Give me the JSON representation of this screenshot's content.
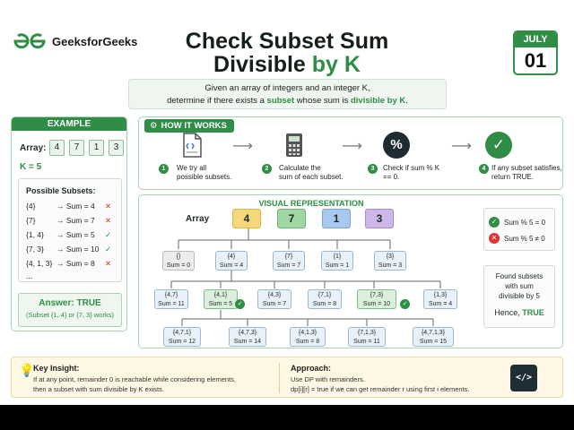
{
  "header": {
    "brand": "GeeksforGeeks",
    "title_line1": "Check Subset Sum",
    "title_line2_prefix": "Divisible ",
    "title_line2_highlight": "by K",
    "date_month": "JULY",
    "date_day": "01"
  },
  "intro": {
    "line1": "Given an array of integers and an integer K,",
    "line2_prefix": "determine if there exists a ",
    "line2_word1": "subset",
    "line2_middle": " whose sum is ",
    "line2_word2": "divisible by K",
    "line2_end": "."
  },
  "example": {
    "title": "EXAMPLE",
    "array_label": "Array:",
    "array": [
      "4",
      "7",
      "1",
      "3"
    ],
    "k_label": "K = 5",
    "subsets_title": "Possible Subsets:",
    "subsets": [
      {
        "set": "{4}",
        "sum": "→ Sum = 4",
        "ok": false
      },
      {
        "set": "{7}",
        "sum": "→ Sum = 7",
        "ok": false
      },
      {
        "set": "{1, 4}",
        "sum": "→ Sum = 5",
        "ok": true
      },
      {
        "set": "{7, 3}",
        "sum": "→ Sum = 10",
        "ok": true
      },
      {
        "set": "{4, 1, 3}",
        "sum": "→ Sum = 8",
        "ok": false
      }
    ],
    "more": "...",
    "answer_title": "Answer: TRUE",
    "answer_sub": "(Subset {1, 4} or {7, 3} works)"
  },
  "how": {
    "title": "HOW IT WORKS",
    "steps": [
      {
        "num": "1",
        "line1": "We try all",
        "line2": "possible subsets."
      },
      {
        "num": "2",
        "line1": "Calculate the",
        "line2": "sum of each subset."
      },
      {
        "num": "3",
        "line1": "Check if sum % K",
        "line2": "== 0."
      },
      {
        "num": "4",
        "line1": "If any subset satisfies,",
        "line2": "return TRUE."
      }
    ]
  },
  "visual": {
    "title": "VISUAL REPRESENTATION",
    "array_label": "Array",
    "array": [
      "4",
      "7",
      "1",
      "3"
    ],
    "level1": [
      {
        "set": "{}",
        "sum": "Sum = 0"
      },
      {
        "set": "{4}",
        "sum": "Sum = 4"
      },
      {
        "set": "{7}",
        "sum": "Sum = 7"
      },
      {
        "set": "{1}",
        "sum": "Sum = 1"
      },
      {
        "set": "{3}",
        "sum": "Sum = 3"
      }
    ],
    "level2": [
      {
        "set": "{4,7}",
        "sum": "Sum = 11"
      },
      {
        "set": "{4,1}",
        "sum": "Sum = 5"
      },
      {
        "set": "{4,3}",
        "sum": "Sum = 7"
      },
      {
        "set": "{7,1}",
        "sum": "Sum = 8"
      },
      {
        "set": "{7,3}",
        "sum": "Sum = 10"
      },
      {
        "set": "{1,3}",
        "sum": "Sum = 4"
      }
    ],
    "level3": [
      {
        "set": "{4,7,1}",
        "sum": "Sum = 12"
      },
      {
        "set": "{4,7,3}",
        "sum": "Sum = 14"
      },
      {
        "set": "{4,1,3}",
        "sum": "Sum = 8"
      },
      {
        "set": "{7,1,3}",
        "sum": "Sum = 11"
      },
      {
        "set": "{4,7,1,3}",
        "sum": "Sum = 15"
      }
    ],
    "legend_yes": "Sum % 5 = 0",
    "legend_no": "Sum % 5 ≠ 0",
    "found_line1": "Found subsets",
    "found_line2": "with sum",
    "found_line3": "divisible by 5",
    "hence_prefix": "Hence, ",
    "hence_value": "TRUE"
  },
  "insight": {
    "title": "Key Insight:",
    "line1": "If at any point, remainder 0 is reachable while considering elements,",
    "line2": "then a subset with sum divisible by K exists.",
    "approach_title": "Approach:",
    "approach_line1": "Use DP with remainders.",
    "approach_line2": "dp[i][r] = true if we can get remainder r using first i elements.",
    "code_icon_text": "</>"
  },
  "colors": {
    "brand_green": "#2f8d46",
    "error_red": "#d33",
    "arr_4": "#f7d77c",
    "arr_7": "#9fd6a4",
    "arr_1": "#a9c8ef",
    "arr_3": "#cdb7ea"
  }
}
